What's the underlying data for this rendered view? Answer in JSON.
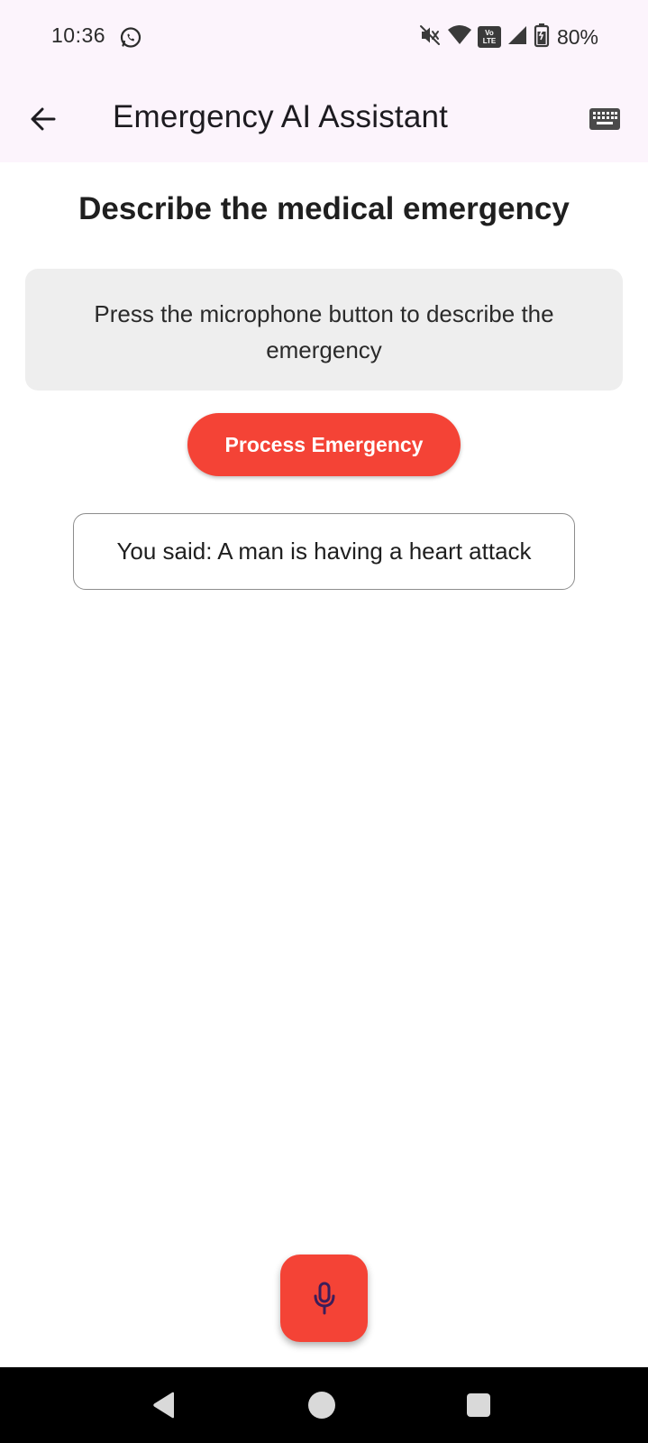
{
  "status_bar": {
    "time": "10:36",
    "battery_text": "80%",
    "volte_label_top": "Vo",
    "volte_label_bottom": "LTE",
    "icons": [
      "whatsapp-icon",
      "mute-icon",
      "wifi-icon",
      "volte-icon",
      "signal-icon",
      "battery-icon"
    ]
  },
  "app_bar": {
    "title": "Emergency AI Assistant",
    "back_icon": "arrow-left-icon",
    "keyboard_icon": "keyboard-icon"
  },
  "main": {
    "heading": "Describe the medical emergency",
    "instruction": "Press the microphone button to describe the emergency",
    "process_button_label": "Process Emergency",
    "transcript": "You said: A man is having a heart attack"
  },
  "fab": {
    "icon": "microphone-icon"
  },
  "nav_bar": {
    "icons": [
      "nav-back-icon",
      "nav-home-icon",
      "nav-recents-icon"
    ]
  },
  "colors": {
    "accent": "#f44336",
    "app_bar_bg": "#fcf4fc",
    "instruction_bg": "#eeeeee",
    "mic_icon": "#3b1d5a"
  }
}
